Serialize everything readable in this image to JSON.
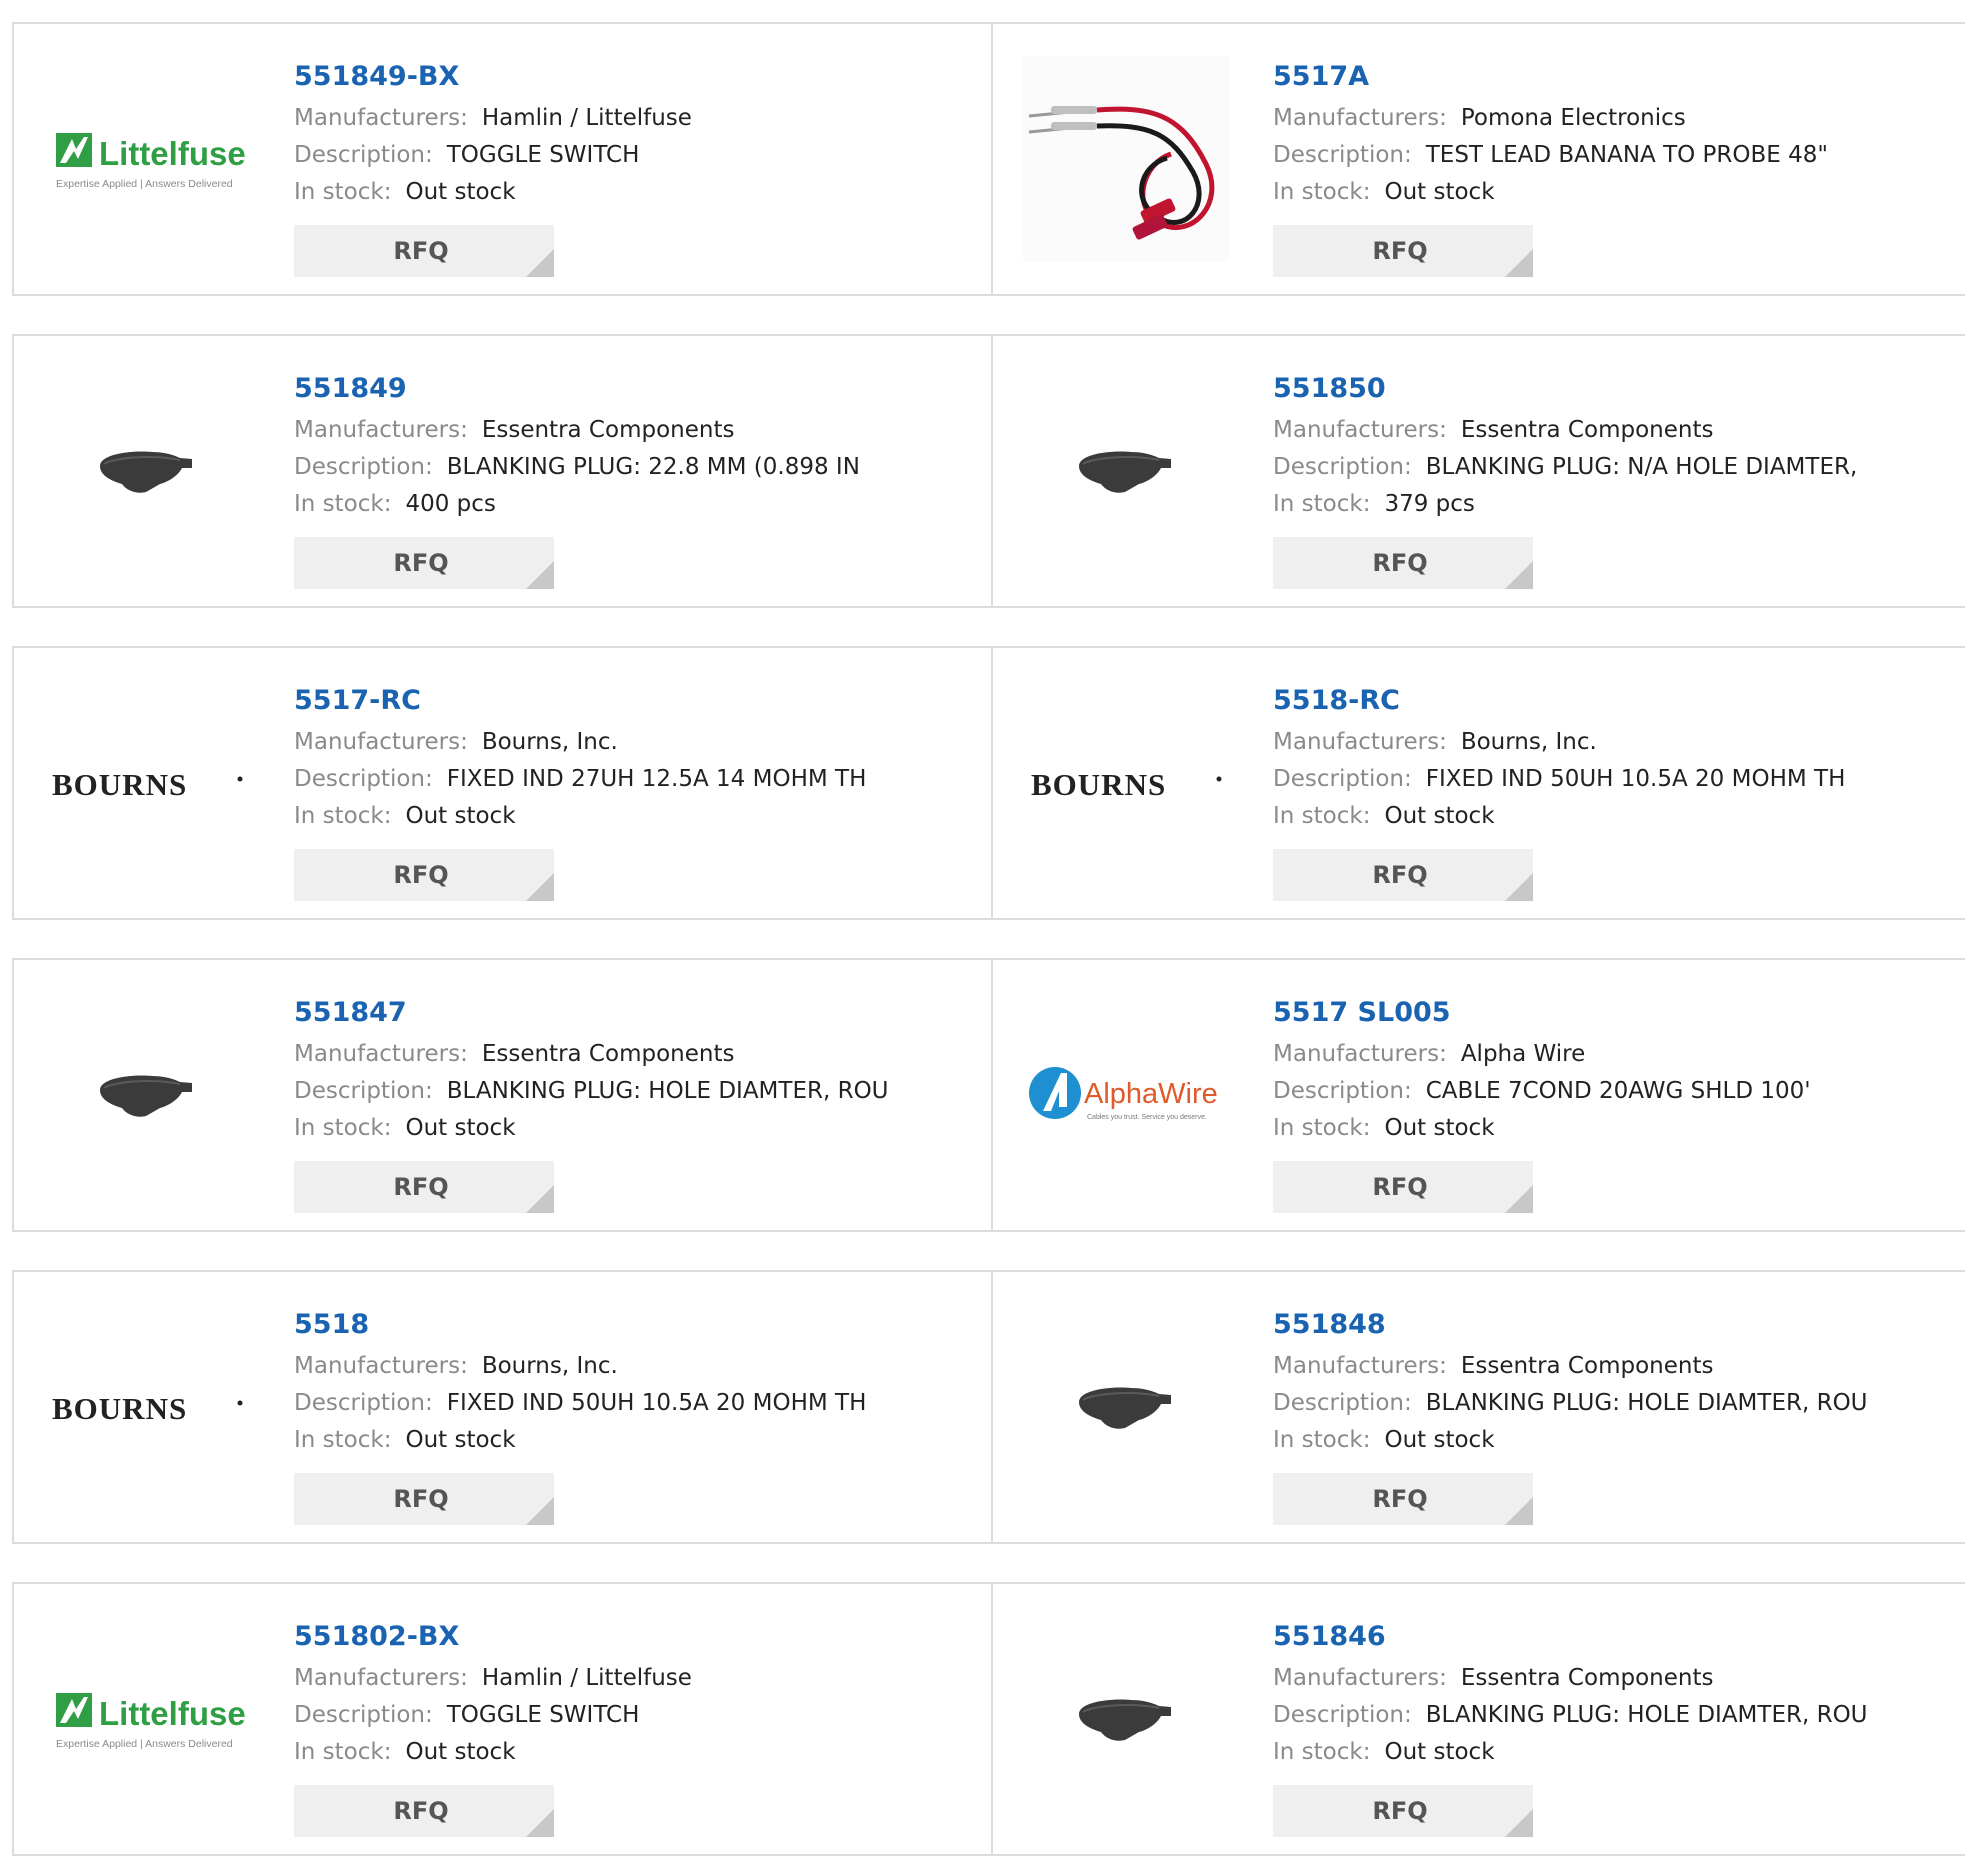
{
  "labels": {
    "manufacturers": "Manufacturers:",
    "description": "Description:",
    "in_stock": "In stock:",
    "rfq": "RFQ"
  },
  "brands": {
    "littelfuse_name": "Littelfuse",
    "littelfuse_tagline": "Expertise Applied | Answers Delivered",
    "bourns": "BOURNS",
    "alphawire_name": "AlphaWire",
    "alphawire_tagline": "Cables you trust. Service you deserve."
  },
  "colors": {
    "link": "#1a63b0",
    "littelfuse_green": "#2f9e44",
    "alphawire_blue": "#1e8fd0"
  },
  "products": [
    {
      "pn": "551849-BX",
      "manufacturer": "Hamlin / Littelfuse",
      "description": "TOGGLE SWITCH",
      "stock": "Out stock",
      "image": "littelfuse-logo"
    },
    {
      "pn": "5517A",
      "manufacturer": "Pomona Electronics",
      "description": "TEST LEAD BANANA TO PROBE 48\"",
      "stock": "Out stock",
      "image": "test-lead-photo"
    },
    {
      "pn": "551849",
      "manufacturer": "Essentra Components",
      "description": "BLANKING PLUG: 22.8 MM (0.898 IN",
      "stock": "400 pcs",
      "image": "blanking-plug-photo"
    },
    {
      "pn": "551850",
      "manufacturer": "Essentra Components",
      "description": "BLANKING PLUG: N/A HOLE DIAMTER,",
      "stock": "379 pcs",
      "image": "blanking-plug-photo"
    },
    {
      "pn": "5517-RC",
      "manufacturer": "Bourns, Inc.",
      "description": "FIXED IND 27UH 12.5A 14 MOHM TH",
      "stock": "Out stock",
      "image": "bourns-logo"
    },
    {
      "pn": "5518-RC",
      "manufacturer": "Bourns, Inc.",
      "description": "FIXED IND 50UH 10.5A 20 MOHM TH",
      "stock": "Out stock",
      "image": "bourns-logo"
    },
    {
      "pn": "551847",
      "manufacturer": "Essentra Components",
      "description": "BLANKING PLUG: HOLE DIAMTER, ROU",
      "stock": "Out stock",
      "image": "blanking-plug-photo"
    },
    {
      "pn": "5517 SL005",
      "manufacturer": "Alpha Wire",
      "description": "CABLE 7COND 20AWG SHLD 100'",
      "stock": "Out stock",
      "image": "alphawire-logo"
    },
    {
      "pn": "5518",
      "manufacturer": "Bourns, Inc.",
      "description": "FIXED IND 50UH 10.5A 20 MOHM TH",
      "stock": "Out stock",
      "image": "bourns-logo"
    },
    {
      "pn": "551848",
      "manufacturer": "Essentra Components",
      "description": "BLANKING PLUG: HOLE DIAMTER, ROU",
      "stock": "Out stock",
      "image": "blanking-plug-photo"
    },
    {
      "pn": "551802-BX",
      "manufacturer": "Hamlin / Littelfuse",
      "description": "TOGGLE SWITCH",
      "stock": "Out stock",
      "image": "littelfuse-logo"
    },
    {
      "pn": "551846",
      "manufacturer": "Essentra Components",
      "description": "BLANKING PLUG: HOLE DIAMTER, ROU",
      "stock": "Out stock",
      "image": "blanking-plug-photo"
    }
  ]
}
